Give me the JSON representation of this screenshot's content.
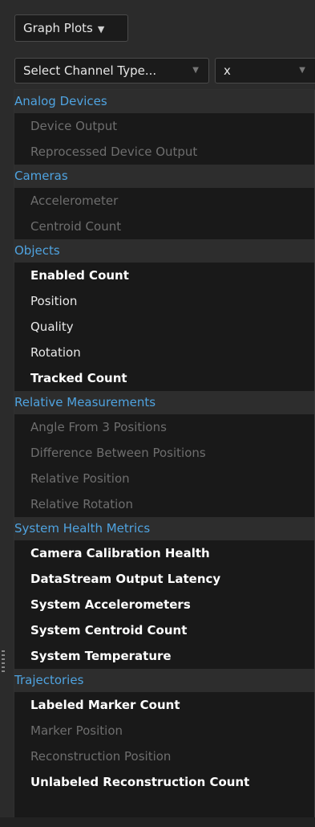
{
  "toolbar": {
    "graph_button_label": "Graph Plots",
    "graph_button_arrow": "▼"
  },
  "selectors": {
    "channel_type": {
      "value": "Select Channel Type...",
      "caret": "▼"
    },
    "axis": {
      "value": "x",
      "caret": "▼"
    }
  },
  "dropdown": {
    "groups": [
      {
        "header": "Analog Devices",
        "items": [
          {
            "label": "Device Output",
            "state": "dim"
          },
          {
            "label": "Reprocessed Device Output",
            "state": "dim"
          }
        ]
      },
      {
        "header": "Cameras",
        "items": [
          {
            "label": "Accelerometer",
            "state": "dim"
          },
          {
            "label": "Centroid Count",
            "state": "dim"
          }
        ]
      },
      {
        "header": "Objects",
        "items": [
          {
            "label": "Enabled Count",
            "state": "bold"
          },
          {
            "label": "Position",
            "state": "normal"
          },
          {
            "label": "Quality",
            "state": "normal"
          },
          {
            "label": "Rotation",
            "state": "normal"
          },
          {
            "label": "Tracked Count",
            "state": "bold"
          }
        ]
      },
      {
        "header": "Relative Measurements",
        "items": [
          {
            "label": "Angle From 3 Positions",
            "state": "dim"
          },
          {
            "label": "Difference Between Positions",
            "state": "dim"
          },
          {
            "label": "Relative Position",
            "state": "dim"
          },
          {
            "label": "Relative Rotation",
            "state": "dim"
          }
        ]
      },
      {
        "header": "System Health Metrics",
        "items": [
          {
            "label": "Camera Calibration Health",
            "state": "bold"
          },
          {
            "label": "DataStream Output Latency",
            "state": "bold"
          },
          {
            "label": "System Accelerometers",
            "state": "bold"
          },
          {
            "label": "System Centroid Count",
            "state": "bold"
          },
          {
            "label": "System Temperature",
            "state": "bold"
          }
        ]
      },
      {
        "header": "Trajectories",
        "items": [
          {
            "label": "Labeled Marker Count",
            "state": "bold"
          },
          {
            "label": "Marker Position",
            "state": "dim"
          },
          {
            "label": "Reconstruction Position",
            "state": "dim"
          },
          {
            "label": "Unlabeled Reconstruction Count",
            "state": "bold"
          }
        ]
      }
    ]
  },
  "colors": {
    "group_header_text": "#4fa3e0",
    "dim_text": "#6e6e6e",
    "menu_background": "#191919"
  }
}
